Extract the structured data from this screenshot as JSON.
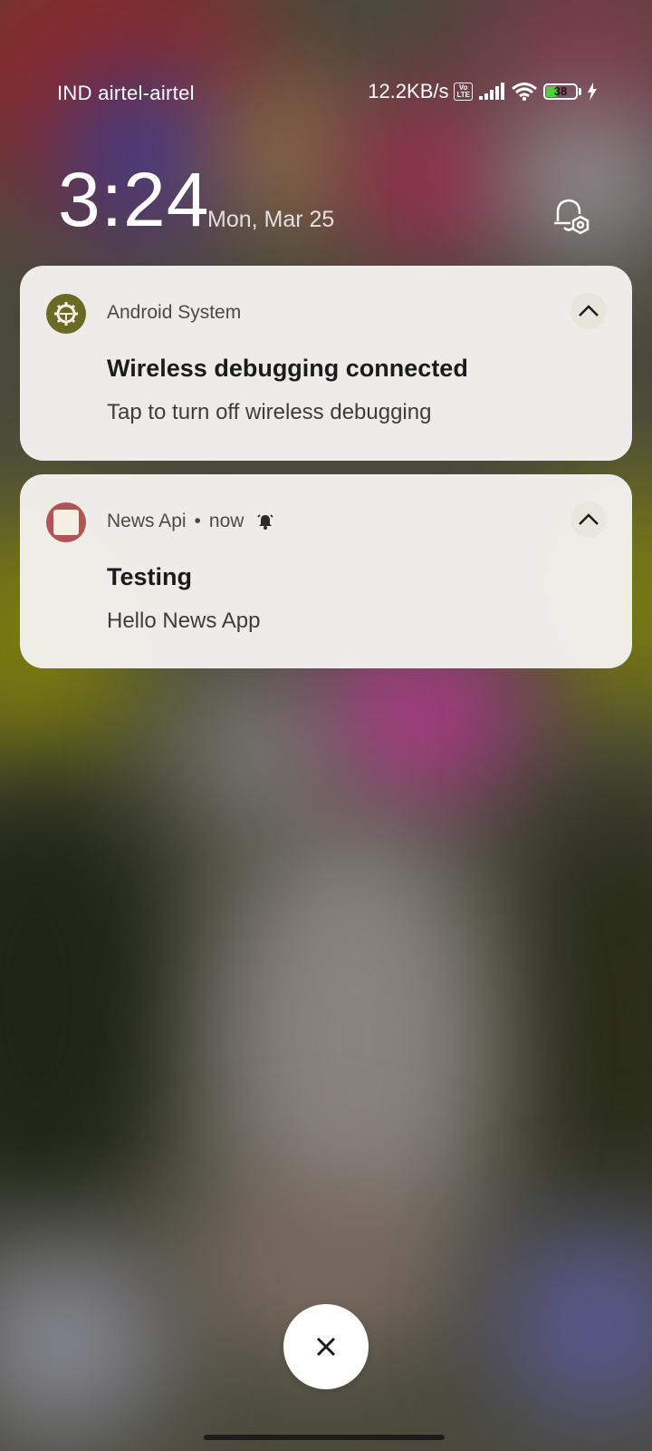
{
  "status_bar": {
    "carrier": "IND airtel-airtel",
    "net_speed": "12.2KB/s",
    "volte_line1": "Vo",
    "volte_line2": "LTE",
    "battery_level": "38",
    "battery_fraction": 0.38,
    "icons": [
      "volte-icon",
      "signal-icon",
      "wifi-icon",
      "battery-icon",
      "charging-icon"
    ]
  },
  "lockscreen": {
    "time": "3:24",
    "date": "Mon, Mar 25"
  },
  "notifications": [
    {
      "app_name": "Android System",
      "title": "Wireless debugging connected",
      "text": "Tap to turn off wireless debugging",
      "icon": "gear-icon",
      "icon_color": "#6b6a24"
    },
    {
      "app_name": "News Api",
      "separator": "•",
      "time": "now",
      "title": "Testing",
      "text": "Hello News App",
      "icon": "news-app-icon",
      "icon_color": "#b05555"
    }
  ],
  "colors": {
    "card_bg": "#f4f3ef",
    "battery_fill": "#4cd137"
  }
}
